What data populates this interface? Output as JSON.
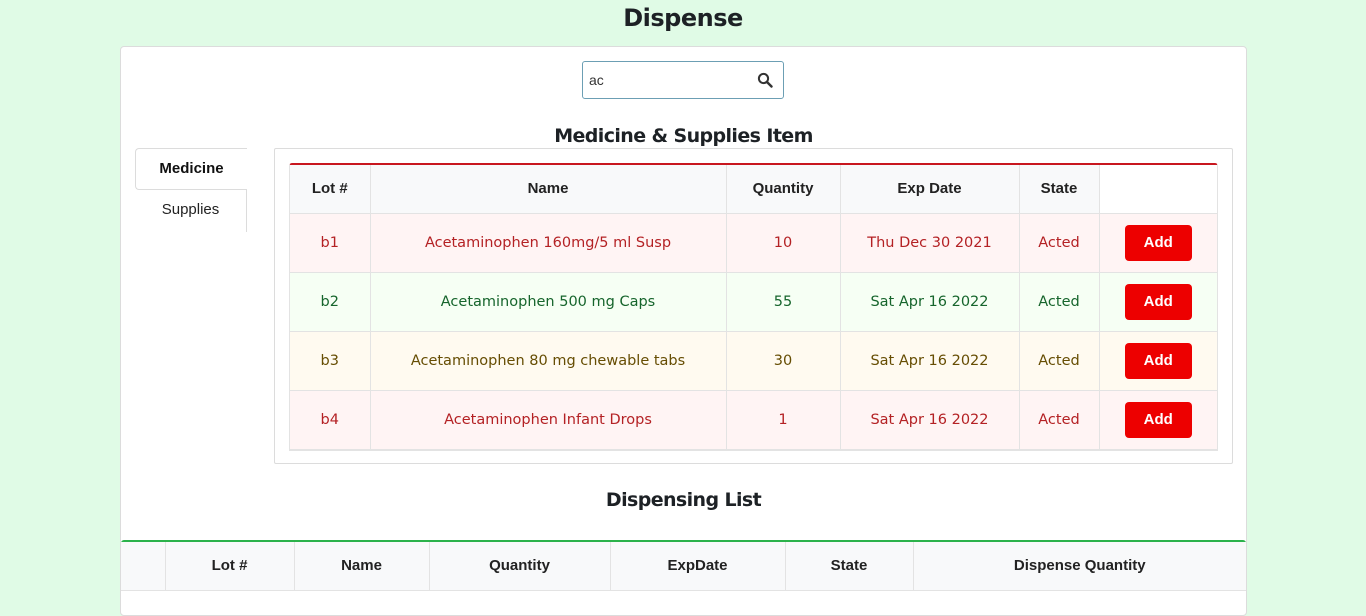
{
  "page": {
    "title": "Dispense"
  },
  "search": {
    "value": "ac",
    "icon": "search-icon"
  },
  "items_section": {
    "title": "Medicine & Supplies Item"
  },
  "tabs": [
    {
      "label": "Medicine",
      "active": true
    },
    {
      "label": "Supplies",
      "active": false
    }
  ],
  "items_table": {
    "headers": [
      "Lot #",
      "Name",
      "Quantity",
      "Exp Date",
      "State"
    ],
    "rows": [
      {
        "lot": "b1",
        "name": "Acetaminophen 160mg/5 ml Susp",
        "quantity": "10",
        "exp": "Thu Dec 30 2021",
        "state": "Acted",
        "action": "Add",
        "status": "danger"
      },
      {
        "lot": "b2",
        "name": "Acetaminophen 500 mg Caps",
        "quantity": "55",
        "exp": "Sat Apr 16 2022",
        "state": "Acted",
        "action": "Add",
        "status": "success"
      },
      {
        "lot": "b3",
        "name": "Acetaminophen 80 mg chewable tabs",
        "quantity": "30",
        "exp": "Sat Apr 16 2022",
        "state": "Acted",
        "action": "Add",
        "status": "warning"
      },
      {
        "lot": "b4",
        "name": "Acetaminophen Infant Drops",
        "quantity": "1",
        "exp": "Sat Apr 16 2022",
        "state": "Acted",
        "action": "Add",
        "status": "danger"
      }
    ]
  },
  "dispensing_section": {
    "title": "Dispensing List"
  },
  "dispense_table": {
    "headers": [
      "",
      "Lot #",
      "Name",
      "Quantity",
      "ExpDate",
      "State",
      "Dispense Quantity"
    ]
  },
  "colors": {
    "background": "#e0fbe6",
    "danger": "#b42124",
    "success": "#16652c",
    "warning": "#664d03",
    "add_button": "#ed0000",
    "items_border": "#c8171f",
    "dispense_border": "#2bb24b"
  }
}
